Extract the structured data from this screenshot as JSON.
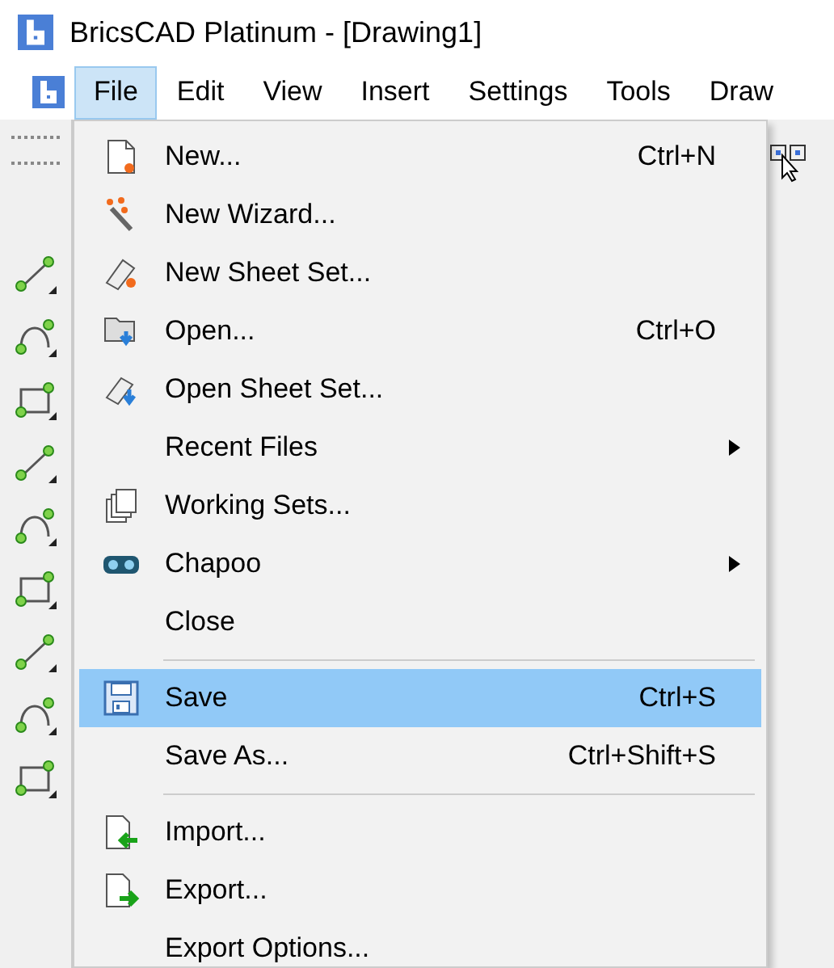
{
  "window": {
    "title": "BricsCAD Platinum - [Drawing1]"
  },
  "menu_bar": [
    {
      "label": "File",
      "selected": true
    },
    {
      "label": "Edit",
      "selected": false
    },
    {
      "label": "View",
      "selected": false
    },
    {
      "label": "Insert",
      "selected": false
    },
    {
      "label": "Settings",
      "selected": false
    },
    {
      "label": "Tools",
      "selected": false
    },
    {
      "label": "Draw",
      "selected": false
    }
  ],
  "file_menu": {
    "items": [
      {
        "kind": "item",
        "label": "New...",
        "shortcut": "Ctrl+N",
        "submenu": false,
        "selected": false
      },
      {
        "kind": "item",
        "label": "New Wizard...",
        "submenu": false,
        "selected": false
      },
      {
        "kind": "item",
        "label": "New Sheet Set...",
        "submenu": false,
        "selected": false
      },
      {
        "kind": "item",
        "label": "Open...",
        "shortcut": "Ctrl+O",
        "submenu": false,
        "selected": false
      },
      {
        "kind": "item",
        "label": "Open Sheet Set...",
        "submenu": false,
        "selected": false
      },
      {
        "kind": "item",
        "label": "Recent Files",
        "submenu": true,
        "selected": false
      },
      {
        "kind": "item",
        "label": "Working Sets...",
        "submenu": false,
        "selected": false
      },
      {
        "kind": "item",
        "label": "Chapoo",
        "submenu": true,
        "selected": false
      },
      {
        "kind": "item",
        "label": "Close",
        "submenu": false,
        "selected": false
      },
      {
        "kind": "separator"
      },
      {
        "kind": "item",
        "label": "Save",
        "shortcut": "Ctrl+S",
        "submenu": false,
        "selected": true
      },
      {
        "kind": "item",
        "label": "Save As...",
        "shortcut": "Ctrl+Shift+S",
        "submenu": false,
        "selected": false
      },
      {
        "kind": "separator"
      },
      {
        "kind": "item",
        "label": "Import...",
        "submenu": false,
        "selected": false
      },
      {
        "kind": "item",
        "label": "Export...",
        "submenu": false,
        "selected": false
      },
      {
        "kind": "item",
        "label": "Export Options...",
        "submenu": false,
        "selected": false
      }
    ]
  }
}
